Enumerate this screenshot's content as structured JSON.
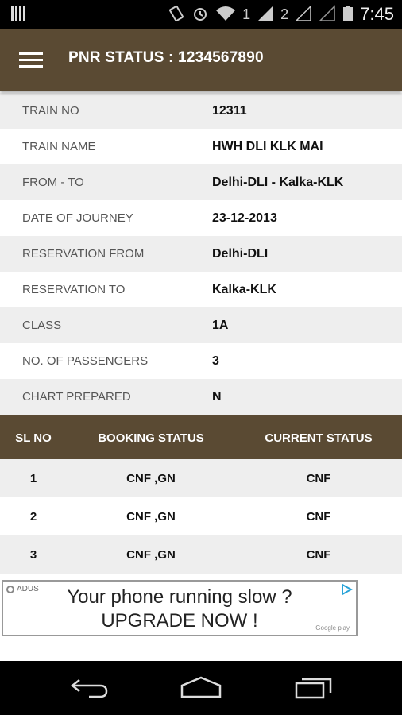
{
  "status_bar": {
    "time": "7:45",
    "sim1": "1",
    "sim2": "2"
  },
  "app_bar": {
    "title": "PNR STATUS : 1234567890",
    "menu_icon": "hamburger-menu-icon"
  },
  "info_rows": [
    {
      "label": "TRAIN NO",
      "value": "12311"
    },
    {
      "label": "TRAIN NAME",
      "value": "HWH DLI KLK MAI"
    },
    {
      "label": "FROM - TO",
      "value": "Delhi-DLI - Kalka-KLK"
    },
    {
      "label": "DATE OF JOURNEY",
      "value": "23-12-2013"
    },
    {
      "label": "RESERVATION FROM",
      "value": "Delhi-DLI"
    },
    {
      "label": "RESERVATION TO",
      "value": "Kalka-KLK"
    },
    {
      "label": "CLASS",
      "value": "1A"
    },
    {
      "label": "NO. OF PASSENGERS",
      "value": "3"
    },
    {
      "label": "CHART PREPARED",
      "value": "N"
    }
  ],
  "passenger_table": {
    "headers": [
      "SL NO",
      "BOOKING STATUS",
      "CURRENT STATUS"
    ],
    "rows": [
      [
        "1",
        "CNF ,GN",
        "CNF"
      ],
      [
        "2",
        "CNF ,GN",
        "CNF"
      ],
      [
        "3",
        "CNF ,GN",
        "CNF"
      ]
    ]
  },
  "ad": {
    "brand": "ADUS",
    "line1": "Your phone running slow ?",
    "line2": "UPGRADE NOW !",
    "store": "Google play"
  },
  "colors": {
    "accent": "#5a4a33",
    "row_alt": "#eeeeee"
  }
}
